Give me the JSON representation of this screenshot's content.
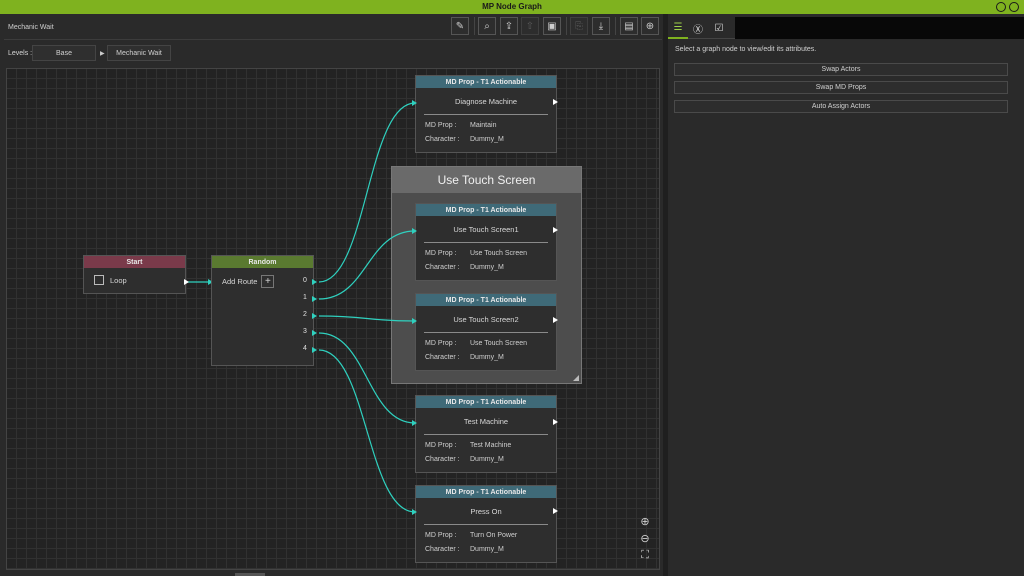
{
  "window": {
    "title": "MP Node Graph"
  },
  "document": {
    "name": "Mechanic Wait"
  },
  "toolbar": {
    "icons": [
      "picker-icon",
      "search-icon",
      "upload-icon",
      "upload-disabled-icon",
      "frame-icon",
      "copy-icon",
      "paste-down-icon",
      "save-icon",
      "new-file-icon"
    ]
  },
  "levels": {
    "label": "Levels :",
    "items": [
      "Base",
      "Mechanic Wait"
    ]
  },
  "group": {
    "title": "Use Touch Screen"
  },
  "start_node": {
    "title": "Start",
    "loop_label": "Loop",
    "color": "#7a3a4a"
  },
  "random_node": {
    "title": "Random",
    "add_route_label": "Add Route",
    "add_symbol": "+",
    "ports": [
      "0",
      "1",
      "2",
      "3",
      "4"
    ],
    "color": "#5a7a30"
  },
  "action_nodes": [
    {
      "header": "MD Prop - T1 Actionable",
      "name": "Diagnose Machine",
      "prop_key": "MD Prop :",
      "prop": "Maintain",
      "char_key": "Character :",
      "character": "Dummy_M"
    },
    {
      "header": "MD Prop - T1 Actionable",
      "name": "Use Touch Screen1",
      "prop_key": "MD Prop :",
      "prop": "Use Touch Screen",
      "char_key": "Character :",
      "character": "Dummy_M"
    },
    {
      "header": "MD Prop - T1 Actionable",
      "name": "Use Touch Screen2",
      "prop_key": "MD Prop :",
      "prop": "Use Touch Screen",
      "char_key": "Character :",
      "character": "Dummy_M"
    },
    {
      "header": "MD Prop - T1 Actionable",
      "name": "Test Machine",
      "prop_key": "MD Prop :",
      "prop": "Test Machine",
      "char_key": "Character :",
      "character": "Dummy_M"
    },
    {
      "header": "MD Prop - T1 Actionable",
      "name": "Press On",
      "prop_key": "MD Prop :",
      "prop": "Turn On Power",
      "char_key": "Character :",
      "character": "Dummy_M"
    }
  ],
  "right_panel": {
    "hint": "Select a graph node to view/edit its attributes.",
    "buttons": [
      "Swap Actors",
      "Swap MD Props",
      "Auto Assign Actors"
    ]
  },
  "colors": {
    "accent": "#7fb21f",
    "wire": "#2fd1bf",
    "action_header": "#3f6a78"
  }
}
